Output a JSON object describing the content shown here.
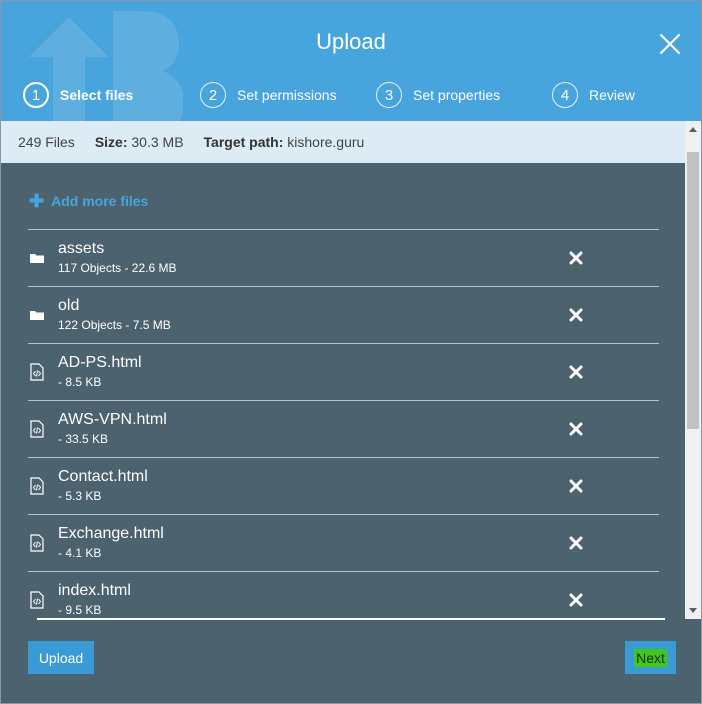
{
  "dialog": {
    "title": "Upload",
    "steps": [
      {
        "number": "1",
        "label": "Select files",
        "active": true
      },
      {
        "number": "2",
        "label": "Set permissions",
        "active": false
      },
      {
        "number": "3",
        "label": "Set properties",
        "active": false
      },
      {
        "number": "4",
        "label": "Review",
        "active": false
      }
    ]
  },
  "summary": {
    "files": "249 Files",
    "size_key": "Size:",
    "size_value": "30.3 MB",
    "path_key": "Target path:",
    "path_value": "kishore.guru"
  },
  "actions": {
    "add_more": "Add more files",
    "upload": "Upload",
    "next": "Next"
  },
  "files": [
    {
      "name": "assets",
      "meta": "117 Objects - 22.6 MB",
      "type": "folder"
    },
    {
      "name": "old",
      "meta": "122 Objects - 7.5 MB",
      "type": "folder"
    },
    {
      "name": "AD-PS.html",
      "meta": "- 8.5 KB",
      "type": "file"
    },
    {
      "name": "AWS-VPN.html",
      "meta": "- 33.5 KB",
      "type": "file"
    },
    {
      "name": "Contact.html",
      "meta": "- 5.3 KB",
      "type": "file"
    },
    {
      "name": "Exchange.html",
      "meta": "- 4.1 KB",
      "type": "file"
    },
    {
      "name": "index.html",
      "meta": "- 9.5 KB",
      "type": "file"
    }
  ],
  "colors": {
    "header": "#48a4dc",
    "panel": "#4d626f",
    "summary_bg": "#dcebf4",
    "button": "#3a9ad6",
    "highlight": "#3ec81a"
  }
}
